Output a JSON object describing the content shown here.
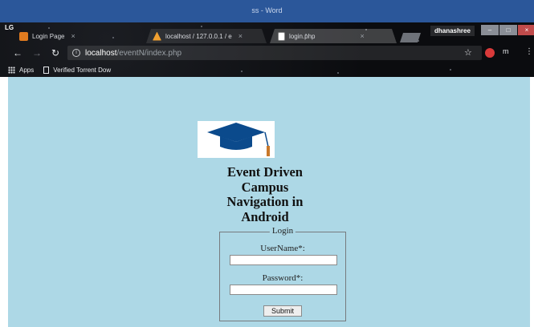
{
  "window": {
    "title": "ss - Word",
    "profile_name": "dhanashree",
    "brand": "LG"
  },
  "tabs": [
    {
      "label": "Login Page",
      "close": "×"
    },
    {
      "label": "localhost / 127.0.0.1 / e",
      "close": "×"
    },
    {
      "label": "login.php",
      "close": "×"
    }
  ],
  "toolbar": {
    "url_host": "localhost",
    "url_path": "/eventN/index.php"
  },
  "bookmarks": {
    "apps": "Apps",
    "item1": "Verified Torrent Dow"
  },
  "page": {
    "heading": [
      "Event Driven",
      "Campus",
      "Navigation in",
      "Android"
    ],
    "login": {
      "legend": "Login",
      "username_label": "UserName*:",
      "username_value": "",
      "password_label": "Password*:",
      "password_value": "",
      "submit_label": "Submit"
    }
  },
  "colors": {
    "page_background": "#add8e6",
    "word_bar": "#2b579a",
    "logo_cap": "#0b4a8c",
    "tassel": "#c8782a"
  },
  "icons": [
    "back-icon",
    "forward-icon",
    "reload-icon",
    "info-icon",
    "star-icon",
    "apps-grid-icon",
    "graduation-cap-icon"
  ]
}
